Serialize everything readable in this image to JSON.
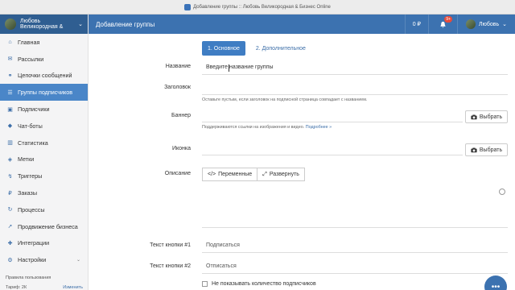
{
  "window": {
    "title": "Добавление группы :: Любовь Великородная & Бизнес Online"
  },
  "sidebar": {
    "user_name": "Любовь Великородная &",
    "items": [
      {
        "label": "Главная",
        "icon": "home-icon"
      },
      {
        "label": "Рассылки",
        "icon": "envelope-icon"
      },
      {
        "label": "Цепочки сообщений",
        "icon": "chain-icon"
      },
      {
        "label": "Группы подписчиков",
        "icon": "group-icon",
        "active": true
      },
      {
        "label": "Подписчики",
        "icon": "users-icon"
      },
      {
        "label": "Чат-боты",
        "icon": "bot-icon"
      },
      {
        "label": "Статистика",
        "icon": "chart-icon"
      },
      {
        "label": "Метки",
        "icon": "tag-icon"
      },
      {
        "label": "Триггеры",
        "icon": "trigger-icon"
      },
      {
        "label": "Заказы",
        "icon": "ruble-icon"
      },
      {
        "label": "Процессы",
        "icon": "process-icon"
      },
      {
        "label": "Продвижение бизнеса",
        "icon": "rocket-icon"
      },
      {
        "label": "Интеграции",
        "icon": "puzzle-icon"
      },
      {
        "label": "Настройки",
        "icon": "gear-icon"
      }
    ],
    "footer_rules": "Правила пользования",
    "footer_tariff": "Тариф: 2К",
    "footer_change": "Изменить"
  },
  "appbar": {
    "title": "Добавление группы",
    "balance": "0 ₽",
    "badge": "9+",
    "user": "Любовь"
  },
  "tabs": [
    "1. Основное",
    "2. Дополнительное"
  ],
  "form": {
    "name_label": "Название",
    "name_placeholder": "Введите название группы",
    "heading_label": "Заголовок",
    "heading_hint": "Оставьте пустым, если заголовок на подписной страница совпадает с названием.",
    "banner_label": "Баннер",
    "banner_hint": "Поддерживаются ссылки на изображения и видео.",
    "banner_hint_link": "Подробнее »",
    "pick_label": "Выбрать",
    "icon_label": "Иконка",
    "desc_label": "Описание",
    "variables_btn": "Переменные",
    "expand_btn": "Развернуть",
    "btn1_label": "Текст кнопки #1",
    "btn1_value": "Подписаться",
    "btn2_label": "Текст кнопки #2",
    "btn2_value": "Отписаться",
    "hide_count_label": "Не показывать количество подписчиков"
  },
  "colors": {
    "accent": "#3c72b0",
    "active": "#4a86c8",
    "badge": "#e74c3c"
  }
}
